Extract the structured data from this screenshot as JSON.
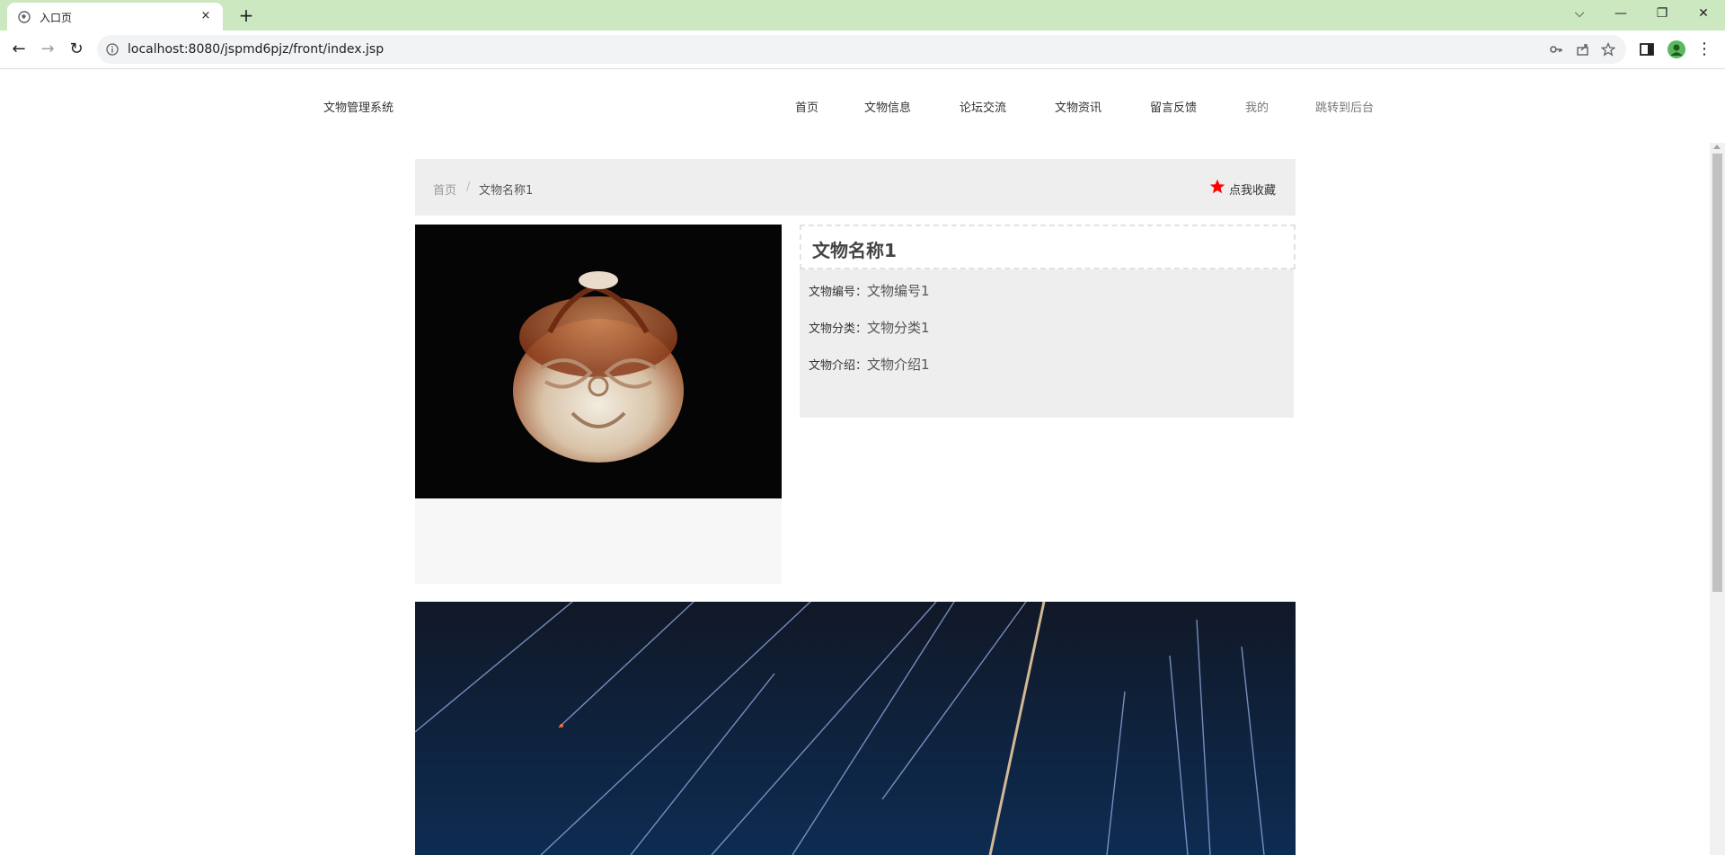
{
  "browser": {
    "tab_title": "入口页",
    "tab_close": "×",
    "new_tab": "+",
    "url": "localhost:8080/jspmd6pjz/front/index.jsp",
    "window_controls": {
      "dropdown": "⌵",
      "minimize": "—",
      "restore": "❐",
      "close": "✕"
    },
    "nav": {
      "back": "←",
      "forward": "→",
      "reload": "↻",
      "menu": "⋮"
    },
    "icons": [
      "globe-icon",
      "info-icon",
      "key-icon",
      "share-icon",
      "bookmark-star-icon",
      "side-panel-icon",
      "profile-avatar-icon"
    ]
  },
  "site": {
    "brand": "文物管理系统",
    "menu": [
      "首页",
      "文物信息",
      "论坛交流",
      "文物资讯",
      "留言反馈",
      "我的",
      "跳转到后台"
    ]
  },
  "breadcrumb": {
    "home": "首页",
    "separator": "/",
    "current": "文物名称1"
  },
  "favorite": {
    "label": "点我收藏",
    "icon": "star-icon",
    "icon_color": "#ff0000"
  },
  "artifact": {
    "title": "文物名称1",
    "fields": [
      {
        "label": "文物编号：",
        "value": "文物编号1"
      },
      {
        "label": "文物分类：",
        "value": "文物分类1"
      },
      {
        "label": "文物介绍：",
        "value": "文物介绍1"
      }
    ]
  },
  "colors": {
    "tabstrip": "#cce8c0",
    "panel_gray": "#eeeeee",
    "favorite_star": "#ff0000",
    "photo_bg": "#050505",
    "banner_bg": "#0c1526"
  }
}
